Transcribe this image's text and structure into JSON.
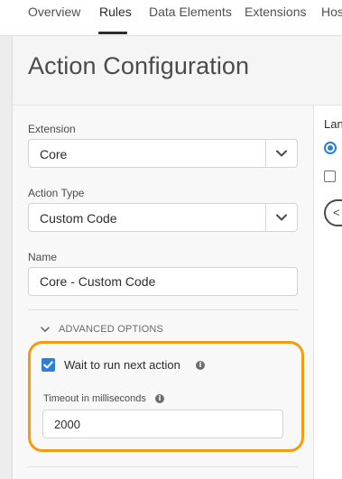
{
  "nav": {
    "tabs": [
      {
        "label": "Overview"
      },
      {
        "label": "Rules"
      },
      {
        "label": "Data Elements"
      },
      {
        "label": "Extensions"
      },
      {
        "label": "Hos"
      }
    ],
    "active_tab": "Rules"
  },
  "page": {
    "title": "Action Configuration"
  },
  "form": {
    "extension": {
      "label": "Extension",
      "value": "Core"
    },
    "action_type": {
      "label": "Action Type",
      "value": "Custom Code"
    },
    "name": {
      "label": "Name",
      "value": "Core - Custom Code"
    },
    "advanced": {
      "toggle_label": "ADVANCED OPTIONS",
      "wait_checkbox": {
        "label": "Wait to run next action",
        "checked": true
      },
      "timeout": {
        "label": "Timeout in milliseconds",
        "value": "2000"
      }
    }
  },
  "right_panel": {
    "lang_label": "Lan",
    "button_glyph": "<"
  },
  "colors": {
    "accent": "#2d7fd6",
    "highlight": "#f59b12"
  }
}
